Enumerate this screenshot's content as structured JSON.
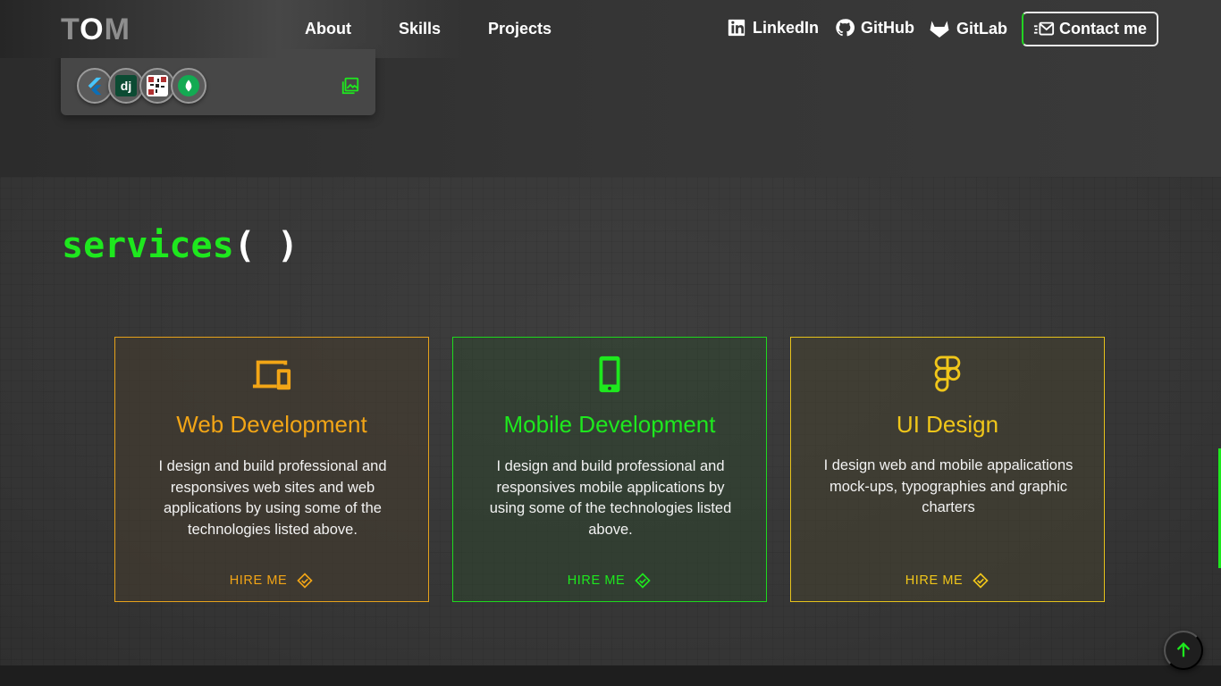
{
  "brand": {
    "logo_left": "T",
    "logo_mid": "O",
    "logo_right": "M"
  },
  "nav": {
    "links": [
      "About",
      "Skills",
      "Projects"
    ],
    "social": [
      {
        "label": "LinkedIn",
        "icon": "linkedin-icon"
      },
      {
        "label": "GitHub",
        "icon": "github-icon"
      },
      {
        "label": "GitLab",
        "icon": "gitlab-icon"
      }
    ],
    "contact_label": "Contact me",
    "contact_icon": "mail-fast-icon"
  },
  "project_card": {
    "tech_icons": [
      "flutter-icon",
      "django-icon",
      "qr-tech-icon",
      "mongodb-icon"
    ],
    "django_text": "dj",
    "gallery_icon": "gallery-icon"
  },
  "services": {
    "title_fn": "services",
    "title_parens": "( )",
    "cards": [
      {
        "title": "Web Development",
        "description": "I design and build professional and responsives web sites and web applications by using some of the technologies listed above.",
        "cta": "HIRE ME",
        "icon": "devices-icon",
        "color": "#f2a516"
      },
      {
        "title": "Mobile Development",
        "description": "I design and build professional and responsives mobile applications by using some of the technologies listed above.",
        "cta": "HIRE ME",
        "icon": "smartphone-icon",
        "color": "#1ee81e"
      },
      {
        "title": "UI Design",
        "description": "I design web and mobile appalications mock-ups, typographies and graphic charters",
        "cta": "HIRE ME",
        "icon": "figma-icon",
        "color": "#f0c61a"
      }
    ]
  },
  "scroll_to_top_icon": "arrow-up-icon",
  "colors": {
    "accent": "#1ee81e",
    "background": "#333333"
  }
}
